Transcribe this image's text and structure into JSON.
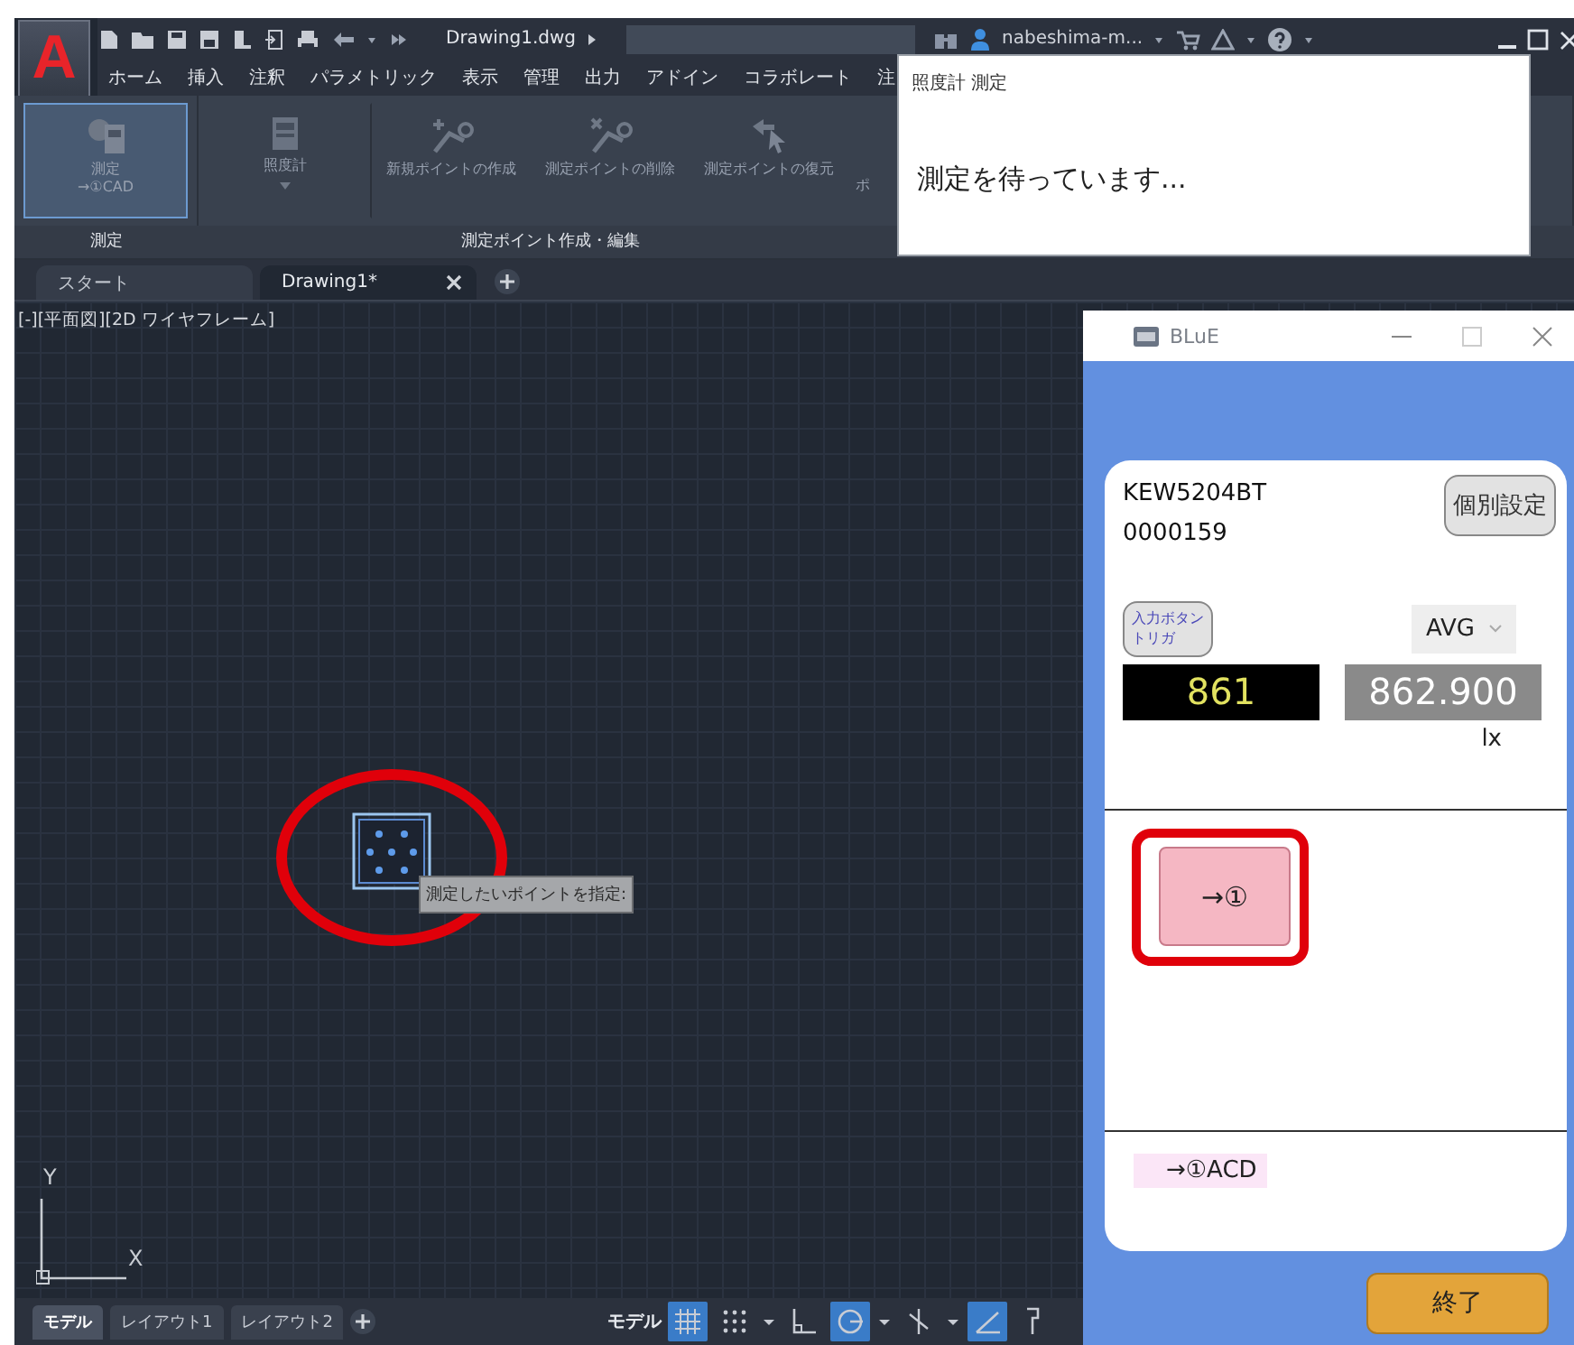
{
  "app": {
    "logo": "A",
    "file_name": "Drawing1.dwg",
    "user": "nabeshima-m...",
    "menu_tabs": [
      {
        "label": "ホーム",
        "selected": false
      },
      {
        "label": "挿入",
        "selected": false
      },
      {
        "label": "注釈",
        "selected": false
      },
      {
        "label": "パラメトリック",
        "selected": false
      },
      {
        "label": "表示",
        "selected": false
      },
      {
        "label": "管理",
        "selected": false
      },
      {
        "label": "出力",
        "selected": false
      },
      {
        "label": "アドイン",
        "selected": false
      },
      {
        "label": "コラボレート",
        "selected": false
      },
      {
        "label": "注",
        "selected": false
      }
    ],
    "ribbon_panels": [
      {
        "title": "測定",
        "buttons": [
          {
            "kind": "meter-cad",
            "label": "測定\n→①CAD",
            "selected": true,
            "disabled": true
          }
        ]
      },
      {
        "title": "測定ポイント作成・編集",
        "buttons": [
          {
            "kind": "meter",
            "label": "照度計",
            "selected": false,
            "disabled": true
          },
          {
            "kind": "add-point",
            "label": "新規ポイントの作成",
            "selected": false,
            "disabled": true
          },
          {
            "kind": "delete-point",
            "label": "測定ポイントの削除",
            "selected": false,
            "disabled": true
          },
          {
            "kind": "restore-point",
            "label": "測定ポイントの復元",
            "selected": false,
            "disabled": true
          },
          {
            "kind": "text",
            "label": "ポ",
            "selected": false,
            "disabled": true
          }
        ]
      }
    ],
    "doc_tabs": [
      {
        "label": "スタート",
        "selected": false
      },
      {
        "label": "Drawing1*",
        "selected": true
      }
    ],
    "viewport_label": "[-][平面図][2D ワイヤフレーム]",
    "tooltip": "測定したいポイントを指定:",
    "ucs": {
      "y": "Y",
      "x": "X"
    },
    "layout_tabs": [
      {
        "label": "モデル",
        "selected": true
      },
      {
        "label": "レイアウト1",
        "selected": false
      },
      {
        "label": "レイアウト2",
        "selected": false
      }
    ],
    "status_bar": {
      "space": "モデル",
      "tools": [
        {
          "kind": "grid",
          "on": true
        },
        {
          "kind": "snap",
          "on": false
        },
        {
          "kind": "menu"
        },
        {
          "kind": "ortho",
          "on": false
        },
        {
          "kind": "polar",
          "on": true
        },
        {
          "kind": "menu"
        },
        {
          "kind": "osnap",
          "on": false
        },
        {
          "kind": "menu"
        },
        {
          "kind": "dynamic",
          "on": true
        },
        {
          "kind": "lineweight",
          "on": false
        }
      ]
    }
  },
  "popup": {
    "title": "照度計 測定",
    "message": "測定を待っています..."
  },
  "blue_window": {
    "title": "BLuE",
    "device_name": "KEW5204BT",
    "serial": "0000159",
    "settings_button": "個別設定",
    "trigger_button": "入力ボタントリガ",
    "mode_select": "AVG",
    "current_reading": "861",
    "average_reading": "862.900",
    "unit": "lx",
    "send_button": "→①",
    "result": "→①ACD",
    "exit_button": "終了"
  }
}
